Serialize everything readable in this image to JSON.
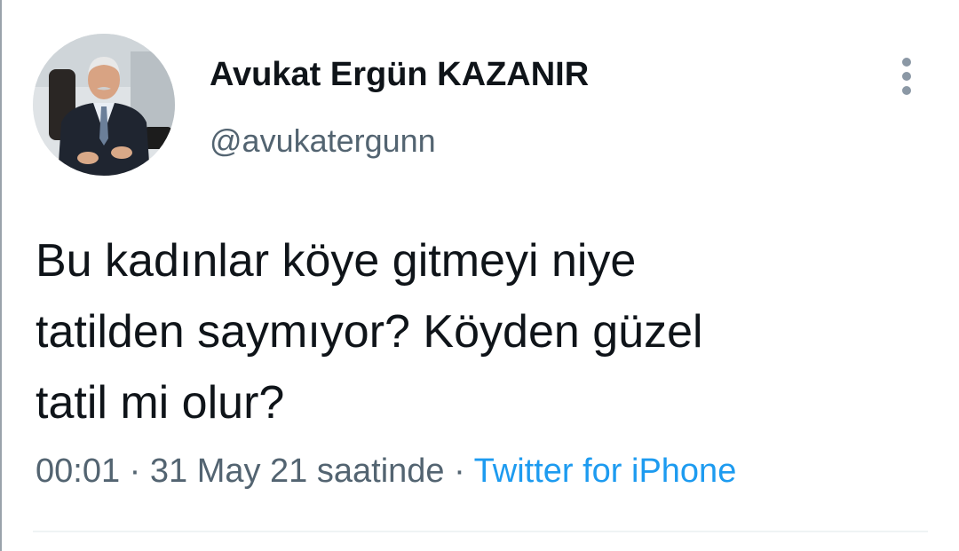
{
  "author": {
    "display_name": "Avukat Ergün KAZANIR",
    "handle": "@avukatergunn",
    "avatar_icon": "profile-photo"
  },
  "tweet": {
    "lines": [
      "Bu kadınlar köye gitmeyi niye",
      "tatilden saymıyor? Köyden güzel",
      "tatil mi olur?"
    ]
  },
  "meta": {
    "time": "00:01",
    "separator": " · ",
    "date": "31 May 21 saatinde",
    "source": "Twitter for iPhone"
  },
  "icons": {
    "more": "more-vertical-icon"
  },
  "colors": {
    "text": "#0f1419",
    "secondary": "#536471",
    "link": "#1d9bf0"
  }
}
